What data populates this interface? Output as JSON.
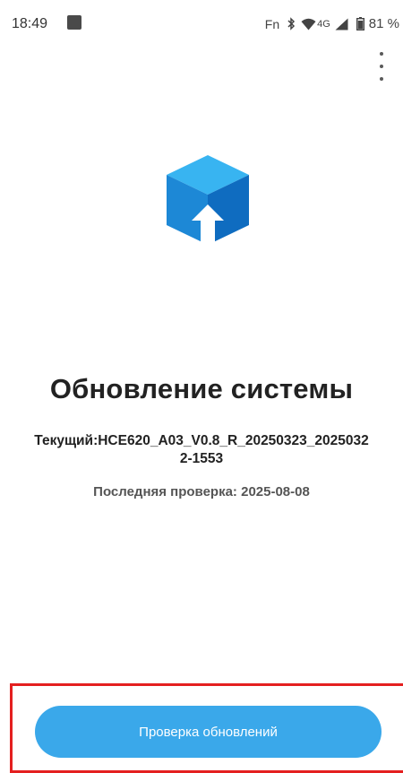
{
  "status_bar": {
    "time": "18:49",
    "fn_label": "Fn",
    "network_label": "4G",
    "battery_percent": "81 %"
  },
  "main": {
    "title": "Обновление системы",
    "current_version_line1": "Текущий:HCE620_A03_V0.8_R_20250323_2025032",
    "current_version_line2": "2-1553",
    "last_check": "Последняя проверка: 2025-08-08"
  },
  "actions": {
    "check_updates_label": "Проверка обновлений"
  },
  "colors": {
    "accent": "#3aa8ea",
    "highlight": "#e41f1f",
    "icon_top": "#38b4f1",
    "icon_left": "#1d88d6",
    "icon_right": "#0f6cc0"
  },
  "icons": {
    "notification": "notification-square-icon",
    "bluetooth": "bluetooth-icon",
    "wifi": "wifi-icon",
    "signal": "cell-signal-icon",
    "battery": "battery-icon",
    "overflow": "more-vert-icon",
    "app": "system-update-box-icon"
  }
}
